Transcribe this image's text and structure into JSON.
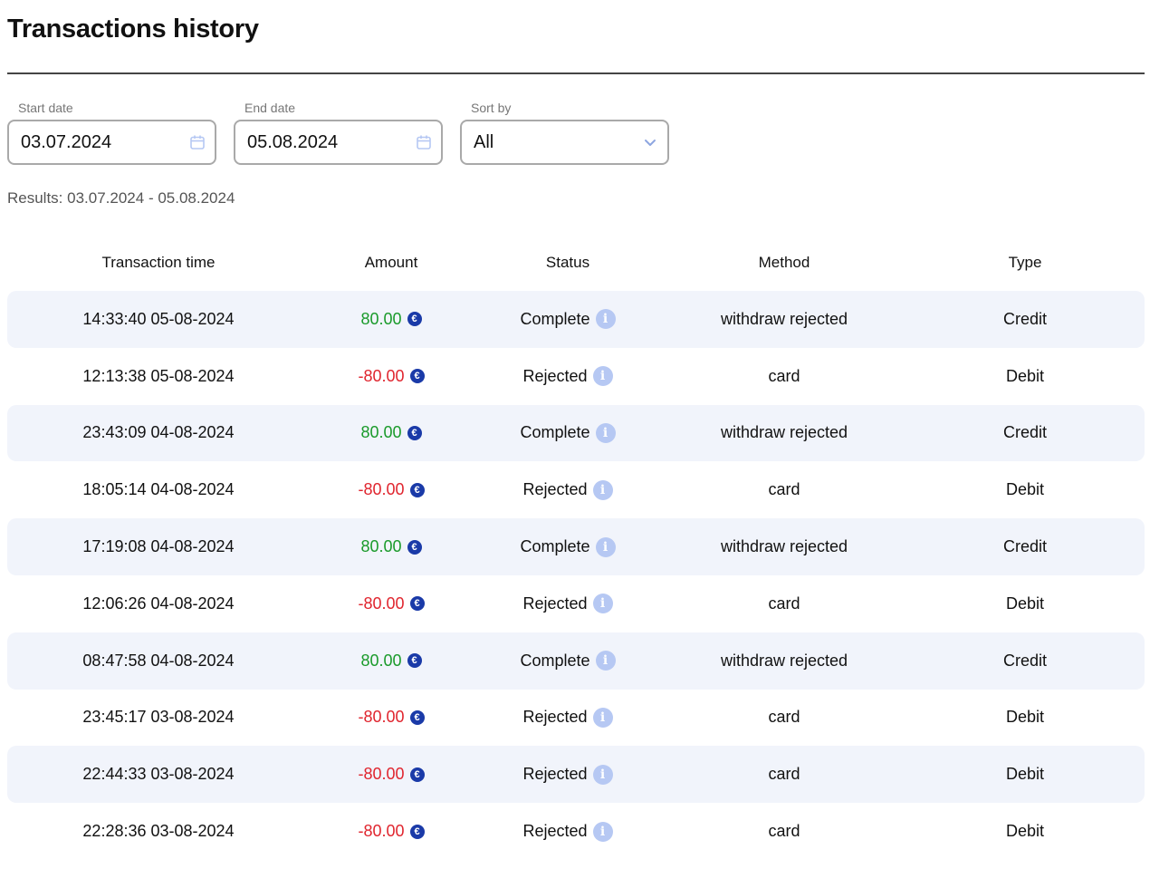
{
  "header": {
    "title": "Transactions history"
  },
  "filters": {
    "start_date": {
      "label": "Start date",
      "value": "03.07.2024",
      "icon": "calendar-icon"
    },
    "end_date": {
      "label": "End date",
      "value": "05.08.2024",
      "icon": "calendar-icon"
    },
    "sort_by": {
      "label": "Sort by",
      "value": "All",
      "icon": "chevron-down-icon"
    }
  },
  "results_text": "Results: 03.07.2024 - 05.08.2024",
  "table": {
    "columns": [
      "Transaction time",
      "Amount",
      "Status",
      "Method",
      "Type"
    ],
    "currency_icon": "euro-icon",
    "status_icon": "info-icon",
    "rows": [
      {
        "time": "14:33:40 05-08-2024",
        "amount": "80.00",
        "status": "Complete",
        "method": "withdraw rejected",
        "type": "Credit"
      },
      {
        "time": "12:13:38 05-08-2024",
        "amount": "-80.00",
        "status": "Rejected",
        "method": "card",
        "type": "Debit"
      },
      {
        "time": "23:43:09 04-08-2024",
        "amount": "80.00",
        "status": "Complete",
        "method": "withdraw rejected",
        "type": "Credit"
      },
      {
        "time": "18:05:14 04-08-2024",
        "amount": "-80.00",
        "status": "Rejected",
        "method": "card",
        "type": "Debit"
      },
      {
        "time": "17:19:08 04-08-2024",
        "amount": "80.00",
        "status": "Complete",
        "method": "withdraw rejected",
        "type": "Credit"
      },
      {
        "time": "12:06:26 04-08-2024",
        "amount": "-80.00",
        "status": "Rejected",
        "method": "card",
        "type": "Debit"
      },
      {
        "time": "08:47:58 04-08-2024",
        "amount": "80.00",
        "status": "Complete",
        "method": "withdraw rejected",
        "type": "Credit"
      },
      {
        "time": "23:45:17 03-08-2024",
        "amount": "-80.00",
        "status": "Rejected",
        "method": "card",
        "type": "Debit"
      },
      {
        "time": "22:44:33 03-08-2024",
        "amount": "-80.00",
        "status": "Rejected",
        "method": "card",
        "type": "Debit"
      },
      {
        "time": "22:28:36 03-08-2024",
        "amount": "-80.00",
        "status": "Rejected",
        "method": "card",
        "type": "Debit"
      }
    ]
  },
  "colors": {
    "positive": "#1a9a2a",
    "negative": "#e0252e",
    "row_shade": "#f1f4fb",
    "euro_badge": "#1a3aa8",
    "info_badge": "#b6c8f3"
  }
}
